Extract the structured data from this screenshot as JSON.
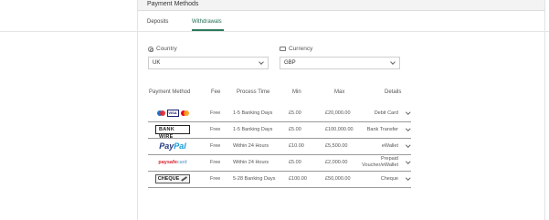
{
  "header": {
    "title": "Payment Methods"
  },
  "tabs": [
    {
      "label": "Deposits",
      "active": false
    },
    {
      "label": "Withdrawals",
      "active": true
    }
  ],
  "filters": {
    "country": {
      "label": "Country",
      "value": "UK",
      "icon": "globe-icon"
    },
    "currency": {
      "label": "Currency",
      "value": "GBP",
      "icon": "money-icon"
    }
  },
  "table": {
    "headers": [
      "Payment Method",
      "Fee",
      "Process Time",
      "Min",
      "Max",
      "Details"
    ],
    "rows": [
      {
        "method": "Debit Card",
        "logo_text": "VISA",
        "fee": "Free",
        "time": "1-5 Banking Days",
        "min": "£5.00",
        "max": "£20,000.00",
        "details": "Debit Card"
      },
      {
        "method": "Bank Wire",
        "logo_text": "BANK WIRE",
        "fee": "Free",
        "time": "1-5 Banking Days",
        "min": "£5.00",
        "max": "£100,000.00",
        "details": "Bank Transfer"
      },
      {
        "method": "PayPal",
        "logo_text_1": "Pay",
        "logo_text_2": "Pal",
        "fee": "Free",
        "time": "Within 24 Hours",
        "min": "£10.00",
        "max": "£5,500.00",
        "details": "eWallet"
      },
      {
        "method": "paysafecard",
        "logo_text_1": "paysafe",
        "logo_text_2": "card",
        "fee": "Free",
        "time": "Within 24 Hours",
        "min": "£5.00",
        "max": "£2,000.00",
        "details_line1": "Prepaid",
        "details_line2": "Voucher/eWallet"
      },
      {
        "method": "Cheque",
        "logo_text": "CHEQUE",
        "fee": "Free",
        "time": "5-28 Banking Days",
        "min": "£100.00",
        "max": "£50,000.00",
        "details": "Cheque"
      }
    ]
  },
  "colors": {
    "accent": "#2c7a5b",
    "paypal_dark": "#253b80",
    "paypal_light": "#179bd7",
    "paysafe_red": "#d62531"
  }
}
